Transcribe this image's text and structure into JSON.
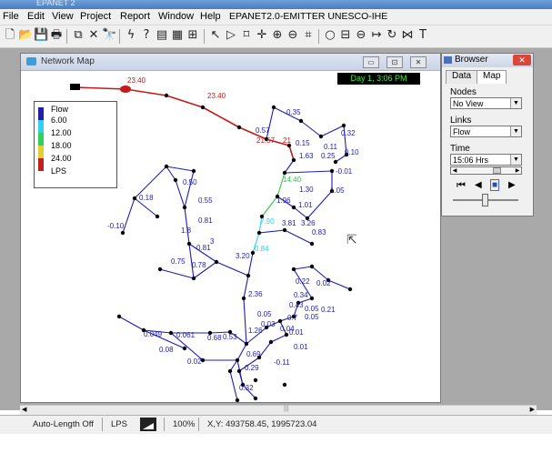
{
  "window": {
    "title": "EPANET 2"
  },
  "menu": [
    "File",
    "Edit",
    "View",
    "Project",
    "Report",
    "Window",
    "Help"
  ],
  "app_caption": "EPANET2.0-EMITTER UNESCO-IHE",
  "map_window": {
    "title": "Network Map",
    "day_time": "Day 1, 3:06 PM",
    "legend": {
      "title": "Flow",
      "entries": [
        "6.00",
        "12.00",
        "18.00",
        "24.00"
      ],
      "units": "LPS",
      "colors": [
        "#1f1fa8",
        "#2fd0f0",
        "#30d060",
        "#e0d030",
        "#c02020"
      ]
    },
    "flow_labels": [
      "23.40",
      "23.40",
      "0.35",
      "0.57",
      "21.57",
      "21",
      "0.15",
      "0.32",
      "0.11",
      "1.63",
      "0.25",
      "0.10",
      "-0.01",
      "14.40",
      "1.30",
      "1.05",
      "1.96",
      "1.01",
      "0.18",
      "0.50",
      "0.55",
      "-0.10",
      "0.81",
      "1.8",
      "0.81",
      "3.81",
      "3.26",
      "0.83",
      "7.90",
      "0.84",
      "3",
      "0.75",
      "0.78",
      "3.20",
      "2.36",
      "0.22",
      "0.02",
      "0.34",
      "0.43",
      "0.05",
      "0.21",
      "0.7",
      "0.05",
      "0.03",
      "1.26",
      "0.04",
      "0.01",
      "0.049",
      "0.061",
      "0.08",
      "0.68",
      "0.53",
      "0.05",
      "0.01",
      "0.69",
      "-0.11",
      "0.29",
      "0.32",
      "0.02"
    ]
  },
  "browser": {
    "title": "Browser",
    "close_label": "✕",
    "tabs": [
      "Data",
      "Map"
    ],
    "nodes_label": "Nodes",
    "nodes_value": "No View",
    "links_label": "Links",
    "links_value": "Flow",
    "time_label": "Time",
    "time_value": "15:06 Hrs",
    "playback_icons": [
      "⏮",
      "◀",
      "■",
      "▶"
    ]
  },
  "status": {
    "auto_length": "Auto-Length Off",
    "units": "LPS",
    "zoom": "100%",
    "xy": "X,Y: 493758.45, 1995723.04"
  }
}
